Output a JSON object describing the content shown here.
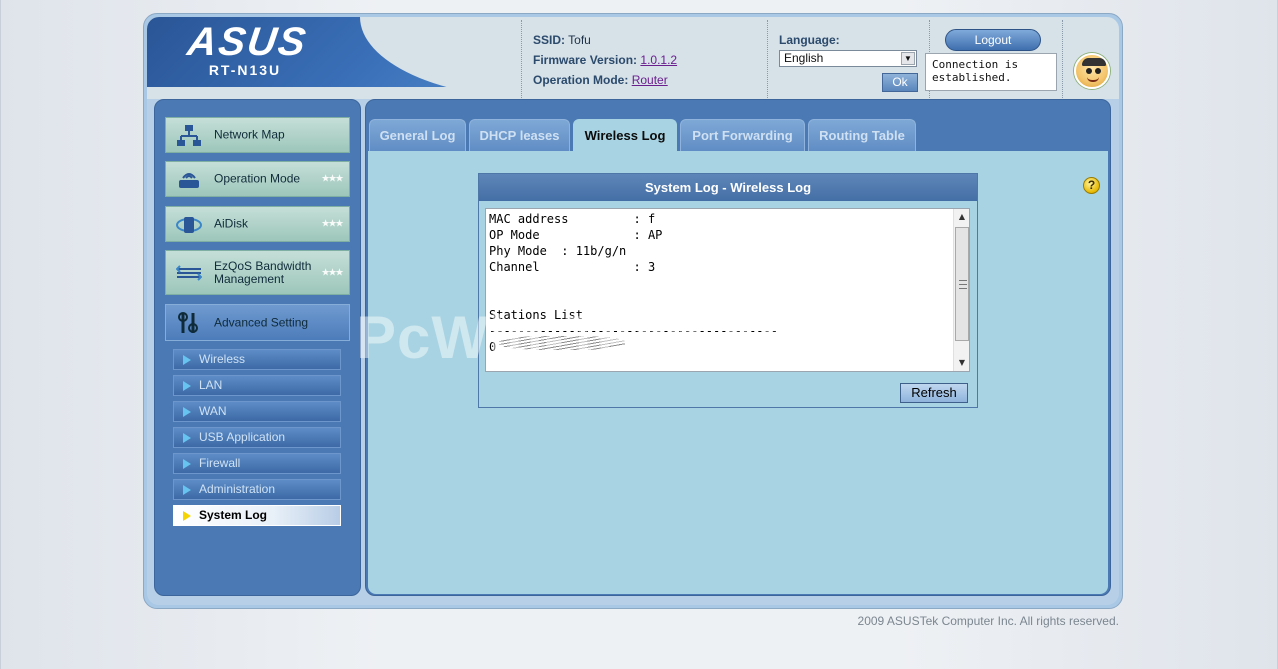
{
  "header": {
    "brand": "ASUS",
    "model": "RT-N13U",
    "ssid_label": "SSID:",
    "ssid_value": "Tofu",
    "firmware_label": "Firmware Version:",
    "firmware_value": "1.0.1.2",
    "opmode_label": "Operation Mode:",
    "opmode_value": "Router",
    "language_label": "Language:",
    "language_value": "English",
    "ok_label": "Ok",
    "logout_label": "Logout",
    "connection_status": "Connection is established."
  },
  "sidebar": {
    "items": [
      {
        "label": "Network Map",
        "icon": "network-map-icon"
      },
      {
        "label": "Operation Mode",
        "icon": "router-icon"
      },
      {
        "label": "AiDisk",
        "icon": "aidisk-icon"
      },
      {
        "label": "EzQoS Bandwidth Management",
        "icon": "ezqos-icon"
      },
      {
        "label": "Advanced Setting",
        "icon": "advanced-setting-icon"
      }
    ],
    "sub_items": [
      {
        "label": "Wireless"
      },
      {
        "label": "LAN"
      },
      {
        "label": "WAN"
      },
      {
        "label": "USB Application"
      },
      {
        "label": "Firewall"
      },
      {
        "label": "Administration"
      },
      {
        "label": "System Log",
        "active": true
      }
    ]
  },
  "tabs": [
    {
      "label": "General Log"
    },
    {
      "label": "DHCP leases"
    },
    {
      "label": "Wireless Log",
      "active": true
    },
    {
      "label": "Port Forwarding"
    },
    {
      "label": "Routing Table"
    }
  ],
  "log": {
    "title": "System Log - Wireless Log",
    "lines": [
      "MAC address         : f",
      "OP Mode             : AP",
      "Phy Mode  : 11b/g/n",
      "Channel             : 3",
      "",
      "",
      "Stations List",
      "----------------------------------------",
      "0"
    ],
    "refresh_label": "Refresh"
  },
  "watermark": "PcWin-Tech.com",
  "footer": "2009 ASUSTek Computer Inc. All rights reserved.",
  "colors": {
    "accent": "#4a79b4",
    "content_bg": "#a8d3e2",
    "link": "#6b1f8f"
  }
}
